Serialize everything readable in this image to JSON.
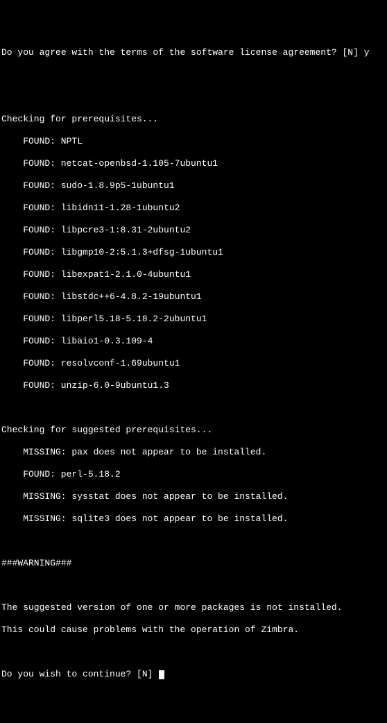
{
  "prompt_agree": "Do you agree with the terms of the software license agreement? [N] ",
  "prompt_agree_answer": "y",
  "checking_prereq": "Checking for prerequisites...",
  "prereq_found": [
    "FOUND: NPTL",
    "FOUND: netcat-openbsd-1.105-7ubuntu1",
    "FOUND: sudo-1.8.9p5-1ubuntu1",
    "FOUND: libidn11-1.28-1ubuntu2",
    "FOUND: libpcre3-1:8.31-2ubuntu2",
    "FOUND: libgmp10-2:5.1.3+dfsg-1ubuntu1",
    "FOUND: libexpat1-2.1.0-4ubuntu1",
    "FOUND: libstdc++6-4.8.2-19ubuntu1",
    "FOUND: libperl5.18-5.18.2-2ubuntu1",
    "FOUND: libaio1-0.3.109-4",
    "FOUND: resolvconf-1.69ubuntu1",
    "FOUND: unzip-6.0-9ubuntu1.3"
  ],
  "checking_suggested": "Checking for suggested prerequisites...",
  "suggested_results": [
    "MISSING: pax does not appear to be installed.",
    "FOUND: perl-5.18.2",
    "MISSING: sysstat does not appear to be installed.",
    "MISSING: sqlite3 does not appear to be installed."
  ],
  "warning_hash": "###WARNING###",
  "warning_line1": "The suggested version of one or more packages is not installed.",
  "warning_line2": "This could cause problems with the operation of Zimbra.",
  "prompt_continue": "Do you wish to continue? [N] "
}
